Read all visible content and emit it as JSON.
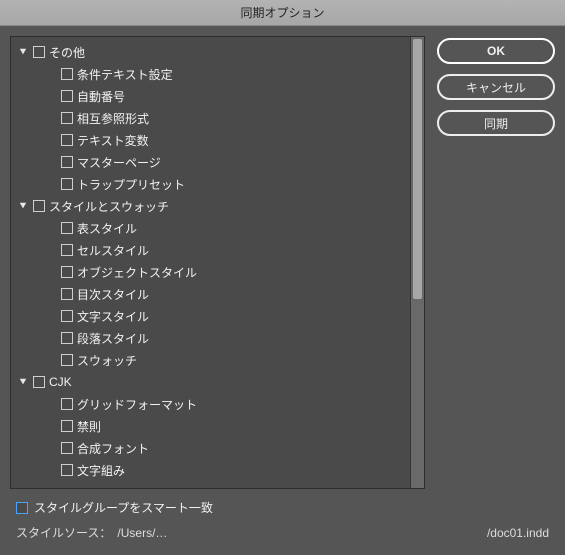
{
  "title": "同期オプション",
  "buttons": {
    "ok": "OK",
    "cancel": "キャンセル",
    "sync": "同期"
  },
  "tree": [
    {
      "kind": "group",
      "label": "その他"
    },
    {
      "kind": "child",
      "label": "条件テキスト設定"
    },
    {
      "kind": "child",
      "label": "自動番号"
    },
    {
      "kind": "child",
      "label": "相互参照形式"
    },
    {
      "kind": "child",
      "label": "テキスト変数"
    },
    {
      "kind": "child",
      "label": "マスターページ"
    },
    {
      "kind": "child",
      "label": "トラッププリセット"
    },
    {
      "kind": "group",
      "label": "スタイルとスウォッチ"
    },
    {
      "kind": "child",
      "label": "表スタイル"
    },
    {
      "kind": "child",
      "label": "セルスタイル"
    },
    {
      "kind": "child",
      "label": "オブジェクトスタイル"
    },
    {
      "kind": "child",
      "label": "目次スタイル"
    },
    {
      "kind": "child",
      "label": "文字スタイル"
    },
    {
      "kind": "child",
      "label": "段落スタイル"
    },
    {
      "kind": "child",
      "label": "スウォッチ"
    },
    {
      "kind": "group",
      "label": "CJK"
    },
    {
      "kind": "child",
      "label": "グリッドフォーマット"
    },
    {
      "kind": "child",
      "label": "禁則"
    },
    {
      "kind": "child",
      "label": "合成フォント"
    },
    {
      "kind": "child",
      "label": "文字組み"
    }
  ],
  "footer": {
    "smart_match_label": "スタイルグループをスマート一致",
    "source_label": "スタイルソース：",
    "source_path": "/Users/…",
    "source_file": "/doc01.indd"
  }
}
